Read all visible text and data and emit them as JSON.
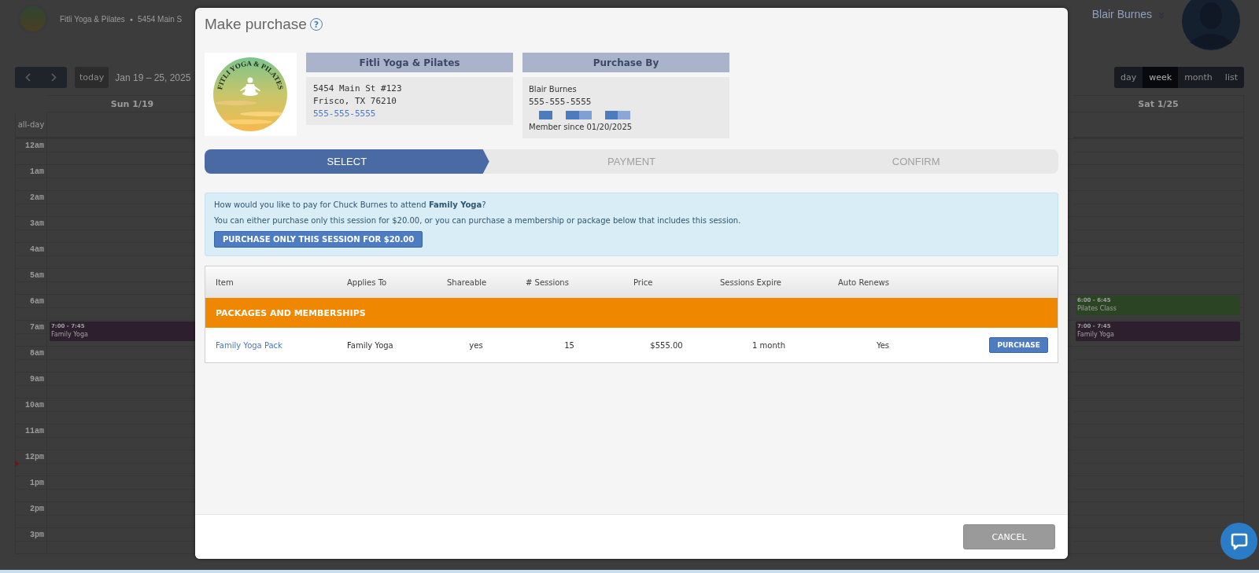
{
  "background": {
    "brand": {
      "name": "Fitli Yoga & Pilates",
      "separator": "●",
      "address": "5454 Main S"
    },
    "user": {
      "name": "Blair Burnes"
    },
    "toolbar": {
      "today": "today",
      "range": "Jan 19 – 25, 2025",
      "views": [
        {
          "label": "day",
          "selected": false
        },
        {
          "label": "week",
          "selected": true
        },
        {
          "label": "month",
          "selected": false
        },
        {
          "label": "list",
          "selected": false
        }
      ]
    },
    "calendar": {
      "sun_header": "Sun 1/19",
      "sat_header": "Sat 1/25",
      "all_day": "all-day",
      "hours": [
        {
          "label": "12am"
        },
        {
          "label": "1am"
        },
        {
          "label": "2am"
        },
        {
          "label": "3am"
        },
        {
          "label": "4am"
        },
        {
          "label": "5am"
        },
        {
          "label": "6am",
          "sat_event": {
            "time": "6:00 - 6:45",
            "title": "Pilates Class",
            "color": "#2b4524"
          }
        },
        {
          "label": "7am",
          "sun_event": {
            "time": "7:00 - 7:45",
            "title": "Family Yoga",
            "color": "#2e1f2e"
          },
          "sat_event": {
            "time": "7:00 - 7:45",
            "title": "Family Yoga",
            "color": "#2e1f2e"
          }
        },
        {
          "label": "8am"
        },
        {
          "label": "9am"
        },
        {
          "label": "10am"
        },
        {
          "label": "11am"
        },
        {
          "label": "12pm"
        },
        {
          "label": "1pm"
        },
        {
          "label": "2pm"
        },
        {
          "label": "3pm"
        }
      ]
    }
  },
  "modal": {
    "title": "Make purchase",
    "help": "?",
    "logo_text": "FITLI YOGA & PILATES",
    "venue": {
      "heading": "Fitli Yoga & Pilates",
      "address_line1": "5454 Main St #123",
      "address_line2": "Frisco, TX 76210",
      "phone": "555-555-5555"
    },
    "purchaser": {
      "heading": "Purchase By",
      "name": "Blair Burnes",
      "phone": "555-555-5555",
      "member_since": "Member since 01/20/2025"
    },
    "steps": [
      {
        "label": "SELECT",
        "selected": true
      },
      {
        "label": "PAYMENT",
        "selected": false
      },
      {
        "label": "CONFIRM",
        "selected": false
      }
    ],
    "notice": {
      "question": "How would you like to pay for Chuck Burnes to attend **Family Yoga**?",
      "detail": "You can either purchase only this session for $20.00, or you can purchase a membership or package below that includes this session.",
      "button": "PURCHASE ONLY THIS SESSION FOR $20.00"
    },
    "table": {
      "columns": [
        "Item",
        "Applies To",
        "Shareable",
        "# Sessions",
        "Price",
        "Sessions Expire",
        "Auto Renews"
      ],
      "group": "PACKAGES AND MEMBERSHIPS",
      "rows": [
        {
          "cells": [
            "Family Yoga Pack",
            "Family Yoga",
            "yes",
            "15",
            "$555.00",
            "1 month",
            "Yes"
          ],
          "action": "PURCHASE"
        }
      ]
    },
    "cancel": "CANCEL"
  }
}
